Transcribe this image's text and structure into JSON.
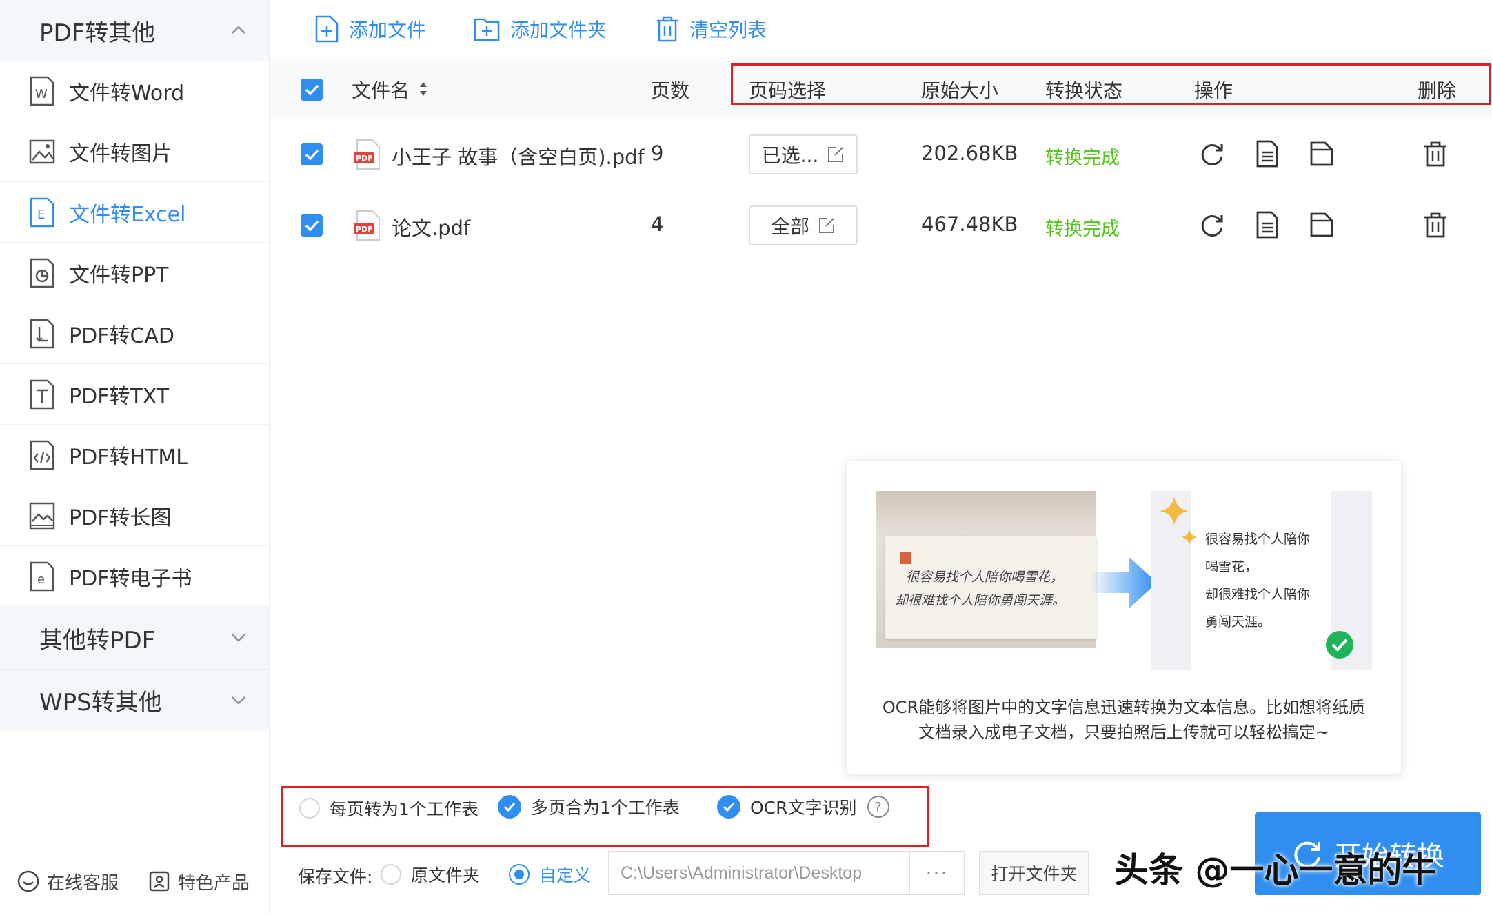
{
  "sidebar": {
    "group_main": "PDF转其他",
    "items": [
      {
        "label": "文件转Word",
        "icon": "word-icon"
      },
      {
        "label": "文件转图片",
        "icon": "image-icon"
      },
      {
        "label": "文件转Excel",
        "icon": "excel-icon",
        "active": true
      },
      {
        "label": "文件转PPT",
        "icon": "ppt-icon"
      },
      {
        "label": "PDF转CAD",
        "icon": "cad-icon"
      },
      {
        "label": "PDF转TXT",
        "icon": "txt-icon"
      },
      {
        "label": "PDF转HTML",
        "icon": "html-icon"
      },
      {
        "label": "PDF转长图",
        "icon": "long-image-icon"
      },
      {
        "label": "PDF转电子书",
        "icon": "ebook-icon"
      }
    ],
    "group_other": "其他转PDF",
    "group_wps": "WPS转其他",
    "footer_service": "在线客服",
    "footer_products": "特色产品"
  },
  "toolbar": {
    "add_file": "添加文件",
    "add_folder": "添加文件夹",
    "clear_list": "清空列表"
  },
  "table": {
    "headers": {
      "filename": "文件名",
      "pages": "页数",
      "page_select": "页码选择",
      "size": "原始大小",
      "status": "转换状态",
      "ops": "操作",
      "delete": "删除"
    },
    "rows": [
      {
        "name": "小王子 故事（含空白页).pdf",
        "pages": "9",
        "selection": "已选...",
        "size": "202.68KB",
        "status": "转换完成"
      },
      {
        "name": "论文.pdf",
        "pages": "4",
        "selection": "全部",
        "size": "467.48KB",
        "status": "转换完成"
      }
    ]
  },
  "ocr_popup": {
    "before_text_line1": "很容易找个人陪你喝雪花，",
    "before_text_line2": "却很难找个人陪你勇闯天涯。",
    "after_lines": [
      "很容易找个人陪你",
      "喝雪花，",
      "却很难找个人陪你",
      "勇闯天涯。"
    ],
    "desc_line1": "OCR能够将图片中的文字信息迅速转换为文本信息。比如想将纸质",
    "desc_line2": "文档录入成电子文档，只要拍照后上传就可以轻松搞定~"
  },
  "options": {
    "per_page_sheet": "每页转为1个工作表",
    "merge_sheet": "多页合为1个工作表",
    "ocr": "OCR文字识别",
    "save_label": "保存文件:",
    "save_original": "原文件夹",
    "save_custom": "自定义",
    "save_path": "C:\\Users\\Administrator\\Desktop",
    "browse": "···",
    "open_folder": "打开文件夹",
    "start": "开始转换"
  },
  "watermark": "头条 @一心一意的牛",
  "colors": {
    "accent": "#2f8ef0",
    "success": "#52c41a",
    "highlight": "#e02020"
  }
}
